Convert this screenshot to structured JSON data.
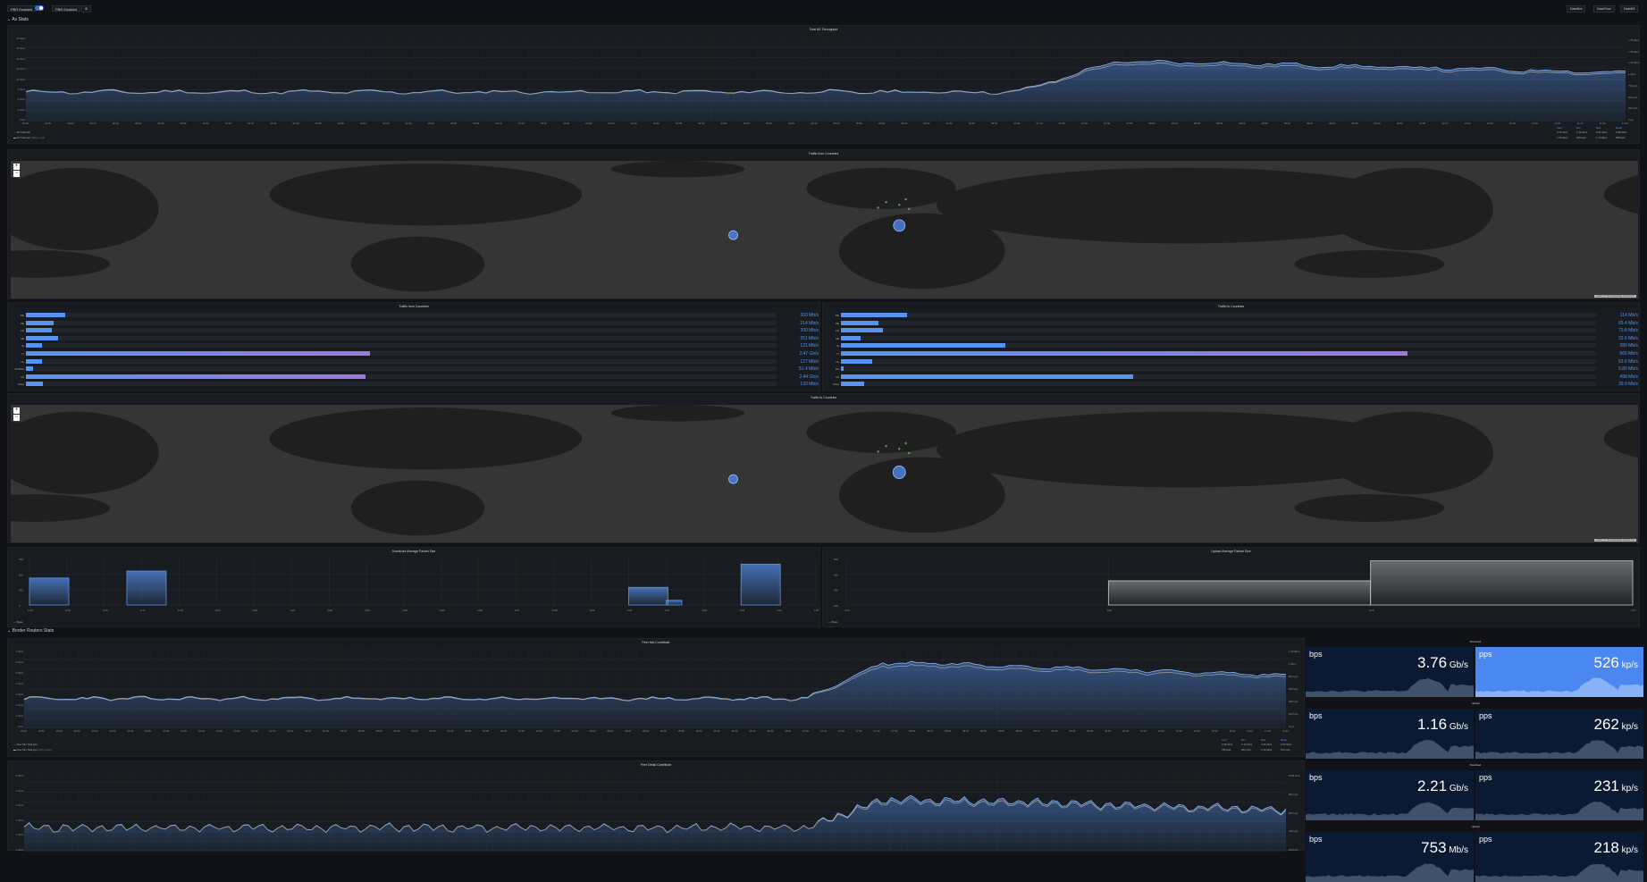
{
  "topbar": {
    "var1_label": "PBR Enabled",
    "var2_label": "PBR Enabled",
    "settings_icon": "gear-icon",
    "btn_dashboard1": "DashBot",
    "btn_dashboard2": "DashFlow",
    "btn_dashboard3": "DashB3"
  },
  "rows": {
    "as_stats": "As Stats",
    "border_routers": "Border Routers Stats"
  },
  "throughput": {
    "title": "Total AS Throughput",
    "y_left": [
      "10 Gb/s",
      "10 Gb/s",
      "10 Gb/s",
      "10 Gb/s",
      "10 Gb/s",
      "0 Gb/s",
      "0 Gb/s",
      "0 Gb/s",
      "0 b/s"
    ],
    "y_right": [
      "1.75 Mp/s",
      "1.50 Mp/s",
      "1.25 Mp/s",
      "1 Mp/s",
      "750 kp/s",
      "500 kp/s",
      "250 kp/s",
      "0 p/s"
    ],
    "legend_headers": [
      "Last *",
      "Min",
      "Max",
      "Mean"
    ],
    "legend": [
      {
        "name": "AS Total bps",
        "values": [
          "3.76 Gb/s",
          "2.19 Gb/s",
          "5.91 Gb/s",
          "3.38 Gb/s"
        ]
      },
      {
        "name": "AS Total pps",
        "suffix": "(right y-axis)",
        "values": [
          "1.09 Mp/s",
          "469 kp/s",
          "1.70 Mp/s",
          "968 kp/s"
        ]
      }
    ]
  },
  "maps": {
    "from_title": "Traffic from Countries",
    "to_title": "Traffic to Countries",
    "zoom_in": "+",
    "zoom_out": "−",
    "attribution": "Leaflet | © OpenStreetMap contributors"
  },
  "from_countries": {
    "title": "Traffic from Countries",
    "items": [
      {
        "code": "BG",
        "value": "303 Mb/s",
        "fraction": 0.052
      },
      {
        "code": "DE",
        "value": "214 Mb/s",
        "fraction": 0.037
      },
      {
        "code": "FR",
        "value": "200 Mb/s",
        "fraction": 0.034
      },
      {
        "code": "GB",
        "value": "251 Mb/s",
        "fraction": 0.043
      },
      {
        "code": "IE",
        "value": "121 Mb/s",
        "fraction": 0.021
      },
      {
        "code": "IT",
        "value": "2.47 Gb/s",
        "fraction": 0.458
      },
      {
        "code": "NL",
        "value": "127 Mb/s",
        "fraction": 0.022
      },
      {
        "code": "RUSSIA",
        "value": "51.4 Mb/s",
        "fraction": 0.009
      },
      {
        "code": "US",
        "value": "2.44 Gb/s",
        "fraction": 0.452
      },
      {
        "code": "Other",
        "value": "133 Mb/s",
        "fraction": 0.023
      }
    ]
  },
  "to_countries": {
    "title": "Traffic to Countries",
    "items": [
      {
        "code": "BG",
        "value": "114 Mb/s",
        "fraction": 0.087
      },
      {
        "code": "DE",
        "value": "65.4 Mb/s",
        "fraction": 0.05
      },
      {
        "code": "FR",
        "value": "73.8 Mb/s",
        "fraction": 0.056
      },
      {
        "code": "GB",
        "value": "33.6 Mb/s",
        "fraction": 0.026
      },
      {
        "code": "IE",
        "value": "280 Mb/s",
        "fraction": 0.218
      },
      {
        "code": "IT",
        "value": "965 Mb/s",
        "fraction": 0.75
      },
      {
        "code": "NL",
        "value": "53.6 Mb/s",
        "fraction": 0.041
      },
      {
        "code": "RU",
        "value": "5.80 Mb/s",
        "fraction": 0.004
      },
      {
        "code": "US",
        "value": "498 Mb/s",
        "fraction": 0.387
      },
      {
        "code": "Other",
        "value": "39.9 Mb/s",
        "fraction": 0.031
      }
    ]
  },
  "download_pkt": {
    "title": "Download Average Packet Size",
    "legend": "Bytes",
    "y": [
      "750",
      "500",
      "250",
      "0"
    ],
    "x": [
      "1/14",
      "1/15",
      "1/16",
      "1/17",
      "1/18",
      "1/19",
      "1/20",
      "1/21",
      "1/22",
      "1/23",
      "1/24",
      "1/25",
      "1/26",
      "1/27",
      "1/28",
      "1/29",
      "1/30",
      "1/31",
      "1/32",
      "1/33",
      "1/34",
      "1/35"
    ]
  },
  "upload_pkt": {
    "title": "Upload Average Packet Size",
    "legend": "Bytes",
    "y": [
      "500",
      "400",
      "300",
      "200"
    ],
    "x": [
      "1/14",
      "1/15",
      "1/16",
      "1/17"
    ]
  },
  "br1": {
    "title": "Peer Mix Contribute",
    "legend_headers": [
      "Last *",
      "Min",
      "Max",
      "Mean"
    ],
    "legend": [
      {
        "name": "Peer Mix Total bps",
        "values": [
          "3.30 Gb/s",
          "1.42 Gb/s",
          "4.65 Gb/s",
          "2.60 Gb/s"
        ]
      },
      {
        "name": "Peer Mix Total pps",
        "suffix": "(right y-axis)",
        "values": [
          "796 kp/s",
          "281 kp/s",
          "1.09 Mp/s",
          "571 kp/s"
        ]
      }
    ],
    "y_left": [
      "7 Gb/s",
      "6 Gb/s",
      "5 Gb/s",
      "4 Gb/s",
      "3 Gb/s",
      "2 Gb/s",
      "1 Gb/s",
      "0 b/s"
    ],
    "y_right": [
      "1.20 Mp/s",
      "1 Mp/s",
      "800 kp/s",
      "600 kp/s",
      "400 kp/s",
      "200 kp/s",
      "0 p/s"
    ]
  },
  "br2": {
    "title": "Peer Detail Contribute",
    "y_left": [
      "4 Gb/s",
      "3 Gb/s",
      "3 Gb/s",
      "2 Gb/s",
      "2 Gb/s",
      "1 Gb/s"
    ],
    "y_right": [
      "1000 kp/s",
      "800 kp/s",
      "600 kp/s",
      "400 kp/s",
      "200 kp/s"
    ]
  },
  "stats": [
    {
      "group": "Download",
      "label": "bps",
      "value": "3.76",
      "unit": "Gb/s"
    },
    {
      "group": "",
      "label": "pps",
      "value": "526",
      "unit": "kp/s"
    },
    {
      "group": "Upload",
      "label": "bps",
      "value": "1.16",
      "unit": "Gb/s"
    },
    {
      "group": "",
      "label": "pps",
      "value": "262",
      "unit": "kp/s"
    },
    {
      "group": "Download",
      "label": "bps",
      "value": "2.21",
      "unit": "Gb/s"
    },
    {
      "group": "",
      "label": "pps",
      "value": "231",
      "unit": "kp/s"
    },
    {
      "group": "Upload",
      "label": "bps",
      "value": "753",
      "unit": "Mb/s"
    },
    {
      "group": "",
      "label": "pps",
      "value": "218",
      "unit": "kp/s"
    }
  ],
  "time_ticks": [
    "23:40",
    "23:50",
    "00:00",
    "00:10",
    "00:20",
    "00:30",
    "00:40",
    "00:50",
    "01:00",
    "01:10",
    "01:20",
    "01:30",
    "01:40",
    "01:50",
    "02:00",
    "02:10",
    "02:20",
    "02:30",
    "02:40",
    "02:50",
    "03:00",
    "03:10",
    "03:20",
    "03:30",
    "03:40",
    "03:50",
    "04:00",
    "04:10",
    "04:20",
    "04:30",
    "04:40",
    "04:50",
    "05:00",
    "05:10",
    "05:20",
    "05:30",
    "05:40",
    "05:50",
    "06:00",
    "06:10",
    "06:20",
    "06:30",
    "06:40",
    "06:50",
    "07:00",
    "07:10",
    "07:20",
    "07:30",
    "07:40",
    "07:50",
    "08:00",
    "08:10",
    "08:20",
    "08:30",
    "08:40",
    "08:50",
    "09:00",
    "09:10",
    "09:20",
    "09:30",
    "09:40",
    "09:50",
    "10:00",
    "10:10",
    "10:20",
    "10:30",
    "10:40",
    "10:50",
    "11:00",
    "11:10",
    "11:20",
    "11:30"
  ],
  "colors": {
    "bg": "#111217",
    "panel": "#181b1f",
    "blue": "#5794f2",
    "purple": "#8f72d9",
    "statbg": "#0b1a33",
    "statbright": "#4a87f0"
  }
}
